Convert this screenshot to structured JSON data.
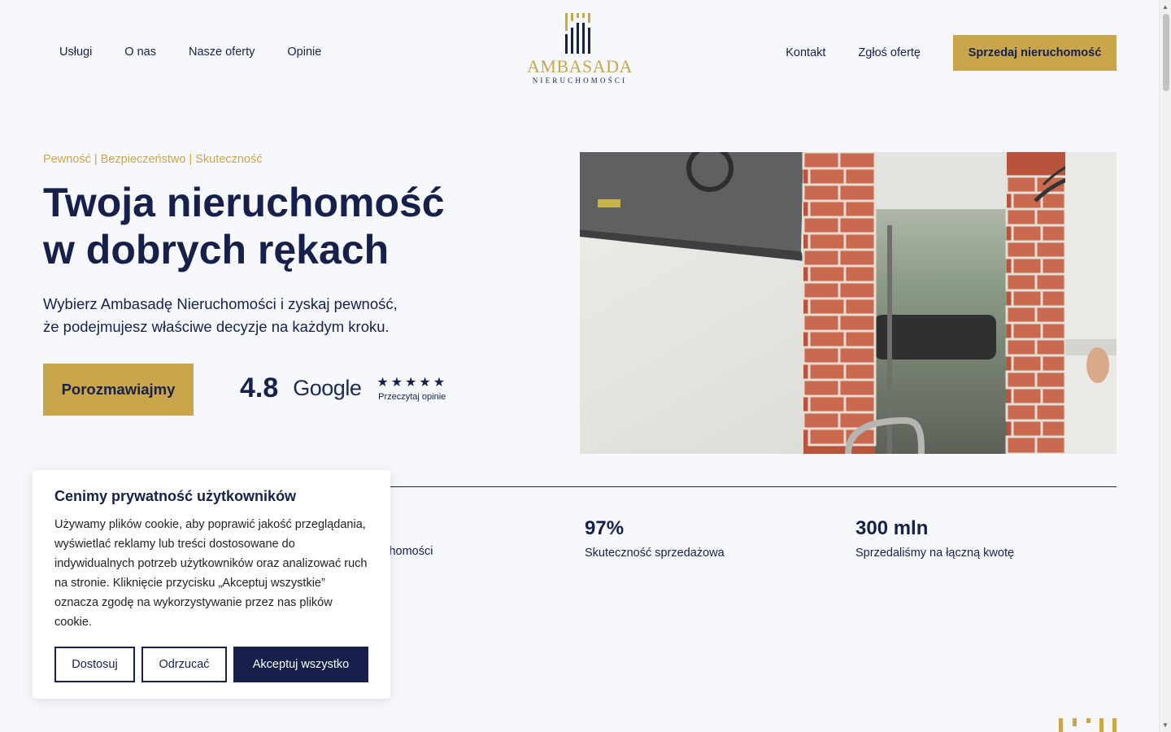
{
  "nav": {
    "left": [
      "Usługi",
      "O nas",
      "Nasze oferty",
      "Opinie"
    ],
    "right": [
      "Kontakt",
      "Zgłoś ofertę"
    ],
    "cta": "Sprzedaj nieruchomość"
  },
  "logo": {
    "name": "AMBASADA",
    "sub": "NIERUCHOMOŚCI"
  },
  "hero": {
    "tagline": "Pewność | Bezpieczeństwo | Skuteczność",
    "title_line1": "Twoja nieruchomość",
    "title_line2": "w dobrych rękach",
    "sub_line1": "Wybierz Ambasadę Nieruchomości i zyskaj pewność,",
    "sub_line2": "że podejmujesz właściwe decyzje na każdym kroku.",
    "cta": "Porozmawiajmy"
  },
  "rating": {
    "value": "4.8",
    "brand": "Google",
    "stars": "★★★★★",
    "stars_count": 5,
    "link": "Przeczytaj opinie"
  },
  "stats": [
    {
      "number": "",
      "label": "wartość nieruchomości"
    },
    {
      "number": "97%",
      "label": "Skuteczność sprzedażowa"
    },
    {
      "number": "300 mln",
      "label": "Sprzedaliśmy na łączną kwotę"
    }
  ],
  "cookie": {
    "title": "Cenimy prywatność użytkowników",
    "text": "Używamy plików cookie, aby poprawić jakość przeglądania, wyświetlać reklamy lub treści dostosowane do indywidualnych potrzeb użytkowników oraz analizować ruch na stronie. Kliknięcie przycisku „Akceptuj wszystkie” oznacza zgodę na wykorzystywanie przez nas plików cookie.",
    "btn_customize": "Dostosuj",
    "btn_reject": "Odrzucać",
    "btn_accept": "Akceptuj wszystko"
  },
  "colors": {
    "navy": "#16204a",
    "gold": "#c9a64b",
    "background": "#f7f8fc"
  }
}
